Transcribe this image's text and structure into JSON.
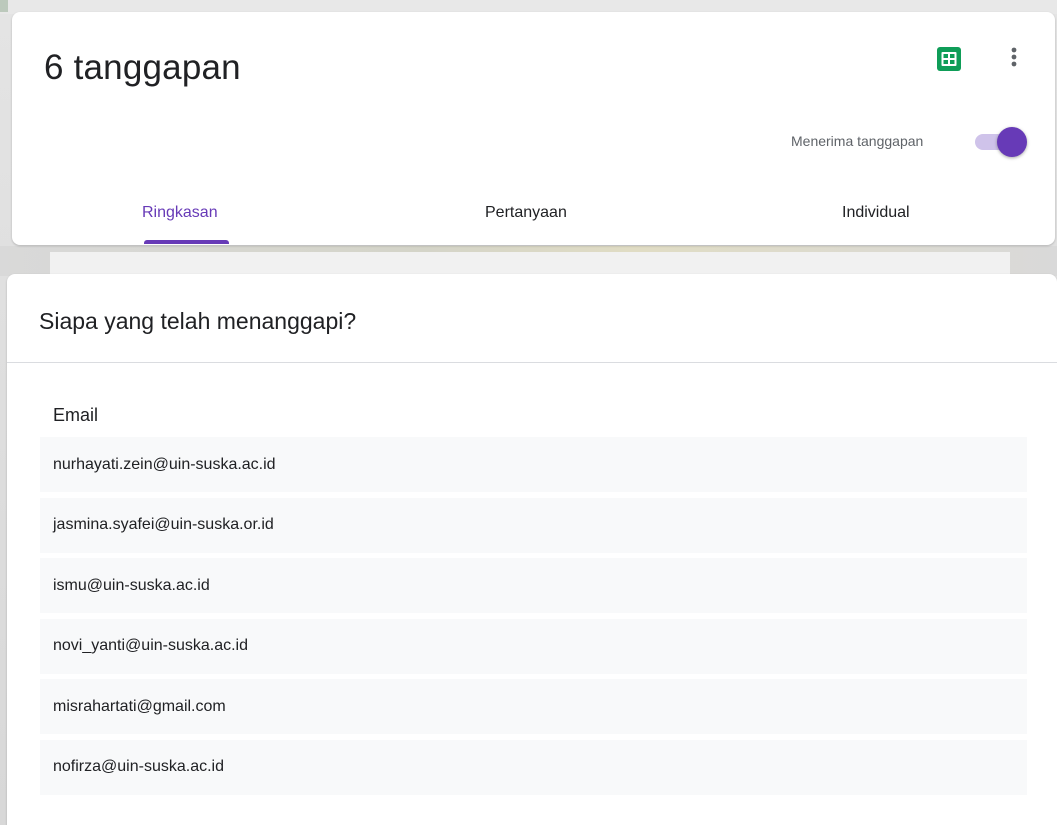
{
  "header": {
    "title": "6 tanggapan",
    "accepting_label": "Menerima tanggapan",
    "accepting_on": true,
    "sheets_icon": "google-sheets-icon",
    "more_icon": "more-vert-icon"
  },
  "tabs": [
    {
      "label": "Ringkasan",
      "active": true
    },
    {
      "label": "Pertanyaan",
      "active": false
    },
    {
      "label": "Individual",
      "active": false
    }
  ],
  "responders": {
    "heading": "Siapa yang telah menanggapi?",
    "column_header": "Email",
    "emails": [
      "nurhayati.zein@uin-suska.ac.id",
      "jasmina.syafei@uin-suska.or.id",
      "ismu@uin-suska.ac.id",
      "novi_yanti@uin-suska.ac.id",
      "misrahartati@gmail.com",
      "nofirza@uin-suska.ac.id"
    ]
  },
  "colors": {
    "accent": "#673ab7",
    "sheets_green": "#0f9d58",
    "toggle_track": "#cfc3ea",
    "row_background": "#f8f9fa"
  }
}
